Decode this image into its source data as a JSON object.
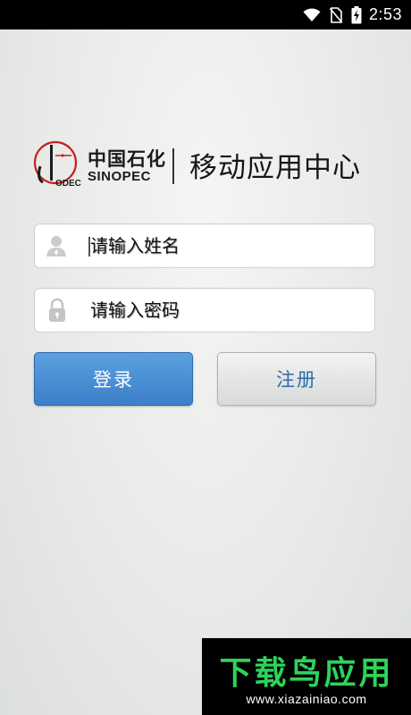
{
  "status_bar": {
    "time": "2:53",
    "icons": [
      "wifi-icon",
      "no-sim-icon",
      "battery-charging-icon"
    ]
  },
  "logo": {
    "company_cn": "中国石化",
    "company_en": "SINOPEC",
    "app_title": "移动应用中心"
  },
  "form": {
    "username": {
      "placeholder": "请输入姓名",
      "value": ""
    },
    "password": {
      "placeholder": "请输入密码",
      "value": ""
    },
    "login_label": "登录",
    "register_label": "注册"
  },
  "watermark": {
    "title": "下载鸟应用",
    "url": "www.xiazainiao.com"
  },
  "colors": {
    "status_bar_bg": "#000000",
    "login_button_bg": "#3b80c9",
    "register_text": "#2f6aa8",
    "watermark_green": "#2ed35a"
  }
}
